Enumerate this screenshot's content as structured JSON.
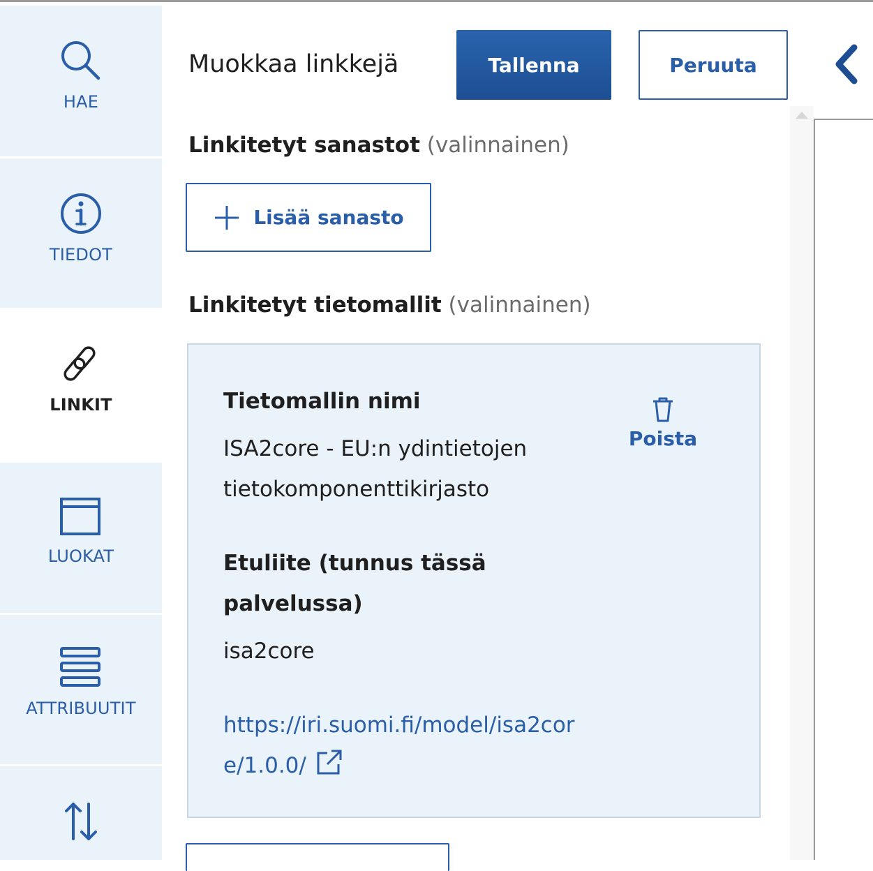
{
  "sidebar": {
    "items": [
      {
        "label": "HAE",
        "icon": "search-icon"
      },
      {
        "label": "TIEDOT",
        "icon": "info-icon"
      },
      {
        "label": "LINKIT",
        "icon": "link-icon",
        "active": true
      },
      {
        "label": "LUOKAT",
        "icon": "window-icon"
      },
      {
        "label": "ATTRIBUUTIT",
        "icon": "list-icon"
      },
      {
        "label": "",
        "icon": "sort-arrows-icon"
      }
    ]
  },
  "header": {
    "title": "Muokkaa linkkejä",
    "save_label": "Tallenna",
    "cancel_label": "Peruuta"
  },
  "vocabularies": {
    "label": "Linkitetyt sanastot",
    "optional": "(valinnainen)",
    "add_label": "Lisää sanasto"
  },
  "datamodels": {
    "label": "Linkitetyt tietomallit",
    "optional": "(valinnainen)",
    "card": {
      "name_label": "Tietomallin nimi",
      "name_value": "ISA2core - EU:n ydintietojen tietokomponenttikirjasto",
      "prefix_label": "Etuliite (tunnus tässä palvelussa)",
      "prefix_value": "isa2core",
      "uri": "https://iri.suomi.fi/model/isa2core/1.0.0/",
      "delete_label": "Poista"
    }
  },
  "colors": {
    "accent": "#2a5ea8",
    "primary_button": "#1d4e93",
    "nav_background": "#eaf2fa",
    "card_background": "#eaf2fa"
  }
}
